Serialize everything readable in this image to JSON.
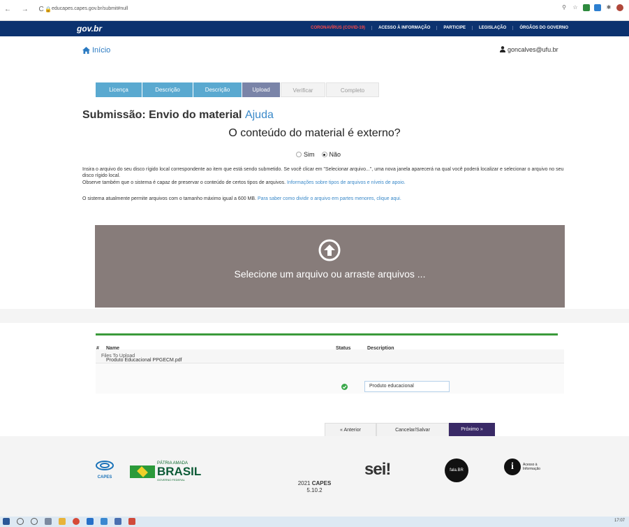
{
  "browser": {
    "url": "educapes.capes.gov.br/submit#null"
  },
  "govbar": {
    "logo": "gov.br",
    "links": [
      "CORONAVÍRUS (COVID-19)",
      "ACESSO À INFORMAÇÃO",
      "PARTICIPE",
      "LEGISLAÇÃO",
      "ÓRGÃOS DO GOVERNO"
    ]
  },
  "header": {
    "home_label": "Início",
    "user_label": "goncalves@ufu.br"
  },
  "steps": [
    {
      "label": "Licença",
      "state": "done"
    },
    {
      "label": "Descrição",
      "state": "done"
    },
    {
      "label": "Descrição",
      "state": "done"
    },
    {
      "label": "Upload",
      "state": "current"
    },
    {
      "label": "Verificar",
      "state": "todo"
    },
    {
      "label": "Completo",
      "state": "todo"
    }
  ],
  "submission": {
    "title": "Submissão: Envio do material",
    "help_link": "Ajuda",
    "external_question": "O conteúdo do material é externo?",
    "option_yes": "Sim",
    "option_no": "Não",
    "selected": "Não"
  },
  "instructions": {
    "p1": "Insira o arquivo do seu disco rígido local correspondente ao item que está sendo submetido. Se você clicar em \"Selecionar arquivo...\", uma nova janela aparecerá na qual você poderá localizar e selecionar o arquivo no seu disco rígido local.",
    "p2_text": "Observe também que o sistema é capaz de preservar o conteúdo de certos tipos de arquivos.",
    "p2_link": "Informações sobre tipos de arquivos e níveis de apoio.",
    "p3_text": "O sistema atualmente permite arquivos com o tamanho máximo igual a 600 MB.",
    "p3_link": "Para saber como dividir o arquivo em partes menores, clique aqui."
  },
  "dropzone": {
    "text": "Selecione um arquivo ou arraste arquivos ..."
  },
  "files": {
    "panel_title": "Files To Upload",
    "columns": {
      "index": "#",
      "name": "Name",
      "status": "Status",
      "description": "Description"
    },
    "rows": [
      {
        "name": "Produto Educacional PPGECM.pdf",
        "status": "ok",
        "description": "Produto educacional"
      }
    ]
  },
  "buttons": {
    "previous": "« Anterior",
    "save": "Cancelar/Salvar",
    "next": "Próximo »"
  },
  "footer": {
    "capes": "CAPES",
    "brasil_top": "PÁTRIA AMADA",
    "brasil_big": "BRASIL",
    "brasil_sub": "GOVERNO FEDERAL",
    "sei": "sei!",
    "falabr": "fala.BR",
    "acesso_1": "Acesso à",
    "acesso_2": "Informação",
    "year": "2021",
    "org": "CAPES",
    "version": "5.10.2"
  },
  "taskbar": {
    "clock": "17:07"
  },
  "colors": {
    "govbar": "#0c326f",
    "step_done": "#5aa9d0",
    "step_current": "#7a84a8",
    "dropzone": "#877c7a",
    "progress": "#3a9a3a",
    "next_button": "#3a2a67",
    "link": "#3a89c9"
  }
}
